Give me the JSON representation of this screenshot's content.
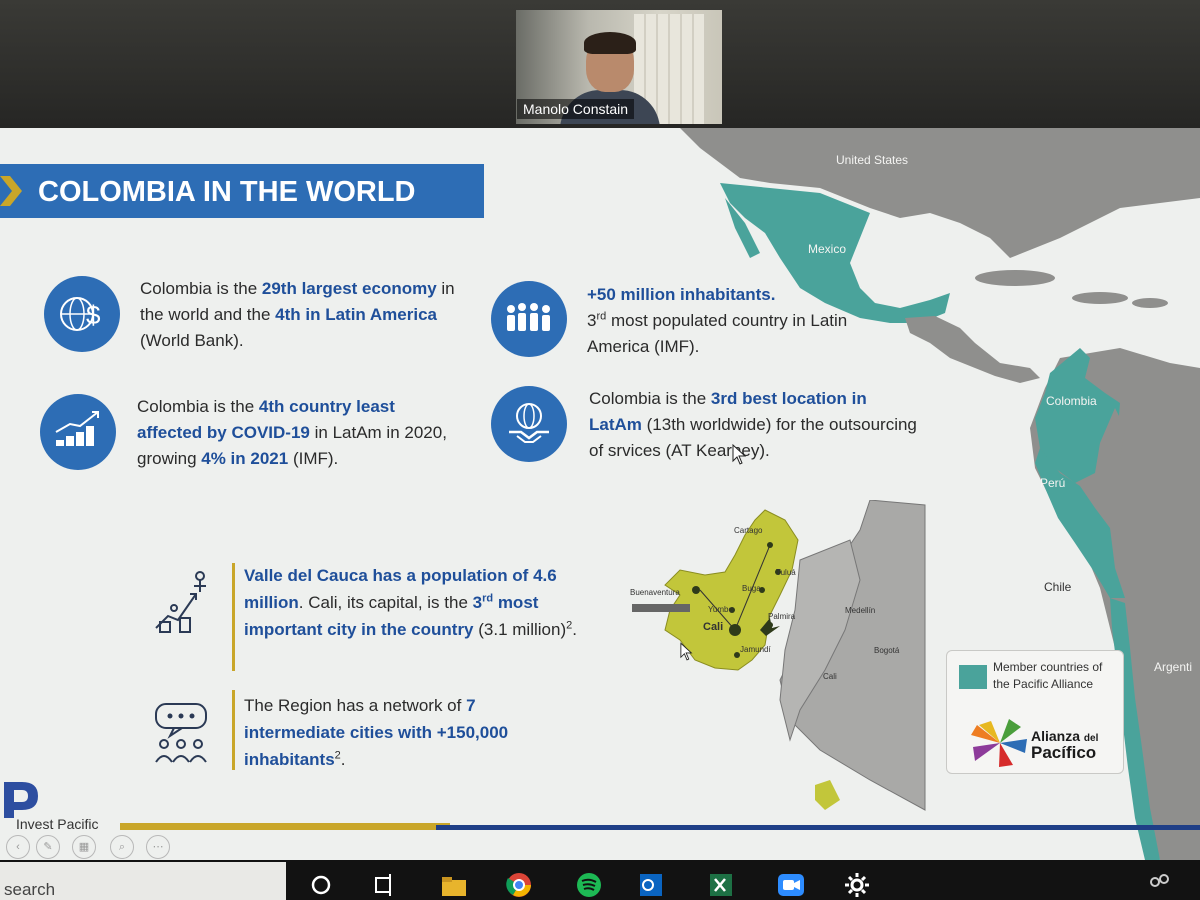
{
  "meeting": {
    "participant_name": "Manolo Constain"
  },
  "slide": {
    "title": "COLOMBIA IN THE WORLD",
    "fact_economy": {
      "icon": "globe-dollar-icon",
      "p1": "Colombia is the ",
      "h1": "29th largest economy",
      "p2": " in the world and the ",
      "h2": "4th in Latin America",
      "p3": " (World Bank)."
    },
    "fact_population": {
      "icon": "crowd-icon",
      "h1": "+50 million inhabitants.",
      "ord": "3",
      "ord_sup": "rd",
      "p1": " most populated country in Latin America (IMF)."
    },
    "fact_covid": {
      "icon": "growth-chart-icon",
      "p1": "Colombia is the ",
      "h1": "4th country least affected by COVID-19",
      "p2": " in LatAm in 2020, growing ",
      "h2": "4% in 2021",
      "p3": " (IMF)."
    },
    "fact_outsourcing": {
      "icon": "handshake-globe-icon",
      "p1": "Colombia is the ",
      "h1": "3rd best location in LatAm",
      "p2": " (13th worldwide) for the outsourcing of s",
      "p3": "rvices (AT Kearney)."
    },
    "valle_population": {
      "icon": "teamwork-climb-icon",
      "h1": "Valle del Cauca has a population of 4.6 million",
      "p1": ". Cali, its capital, is the ",
      "h2_ord": "3",
      "h2_sup": "rd",
      "h2": " most important city in the country",
      "p2": " (3.1 million)",
      "fn": "2",
      "p3": "."
    },
    "valle_network": {
      "icon": "people-chat-icon",
      "p1": "The Region has a network of ",
      "h1a": "7 intermediate",
      "h1b": " cities with +150,000 inhabitants",
      "fn": "2",
      "p2": "."
    },
    "map": {
      "labels": {
        "united_states": "United States",
        "mexico": "Mexico",
        "colombia": "Colombia",
        "peru": "Perú",
        "chile": "Chile",
        "argentina": "Argenti"
      },
      "inset_labels": [
        "Cartago",
        "Tuluá",
        "Buga",
        "Buenaventura",
        "Yumbo",
        "Palmira",
        "Cali",
        "Jamundí",
        "Medellín",
        "Bogotá",
        "Cali"
      ],
      "colors": {
        "member": "#4aa39b",
        "land": "#8f8f8d",
        "valle": "#c2c63a"
      }
    },
    "legend": {
      "text": "Member countries of the Pacific Alliance",
      "alianza_line1": "Alianza",
      "alianza_line2": "del",
      "alianza_line3": "Pacífico"
    },
    "brand": "Invest Pacific",
    "accent_color": "#2d6db5"
  },
  "taskbar": {
    "search_text": "search",
    "apps": [
      "cortana-icon",
      "task-view-icon",
      "file-explorer-icon",
      "chrome-icon",
      "spotify-icon",
      "outlook-icon",
      "excel-icon",
      "zoom-icon",
      "settings-icon",
      "people-icon"
    ]
  }
}
